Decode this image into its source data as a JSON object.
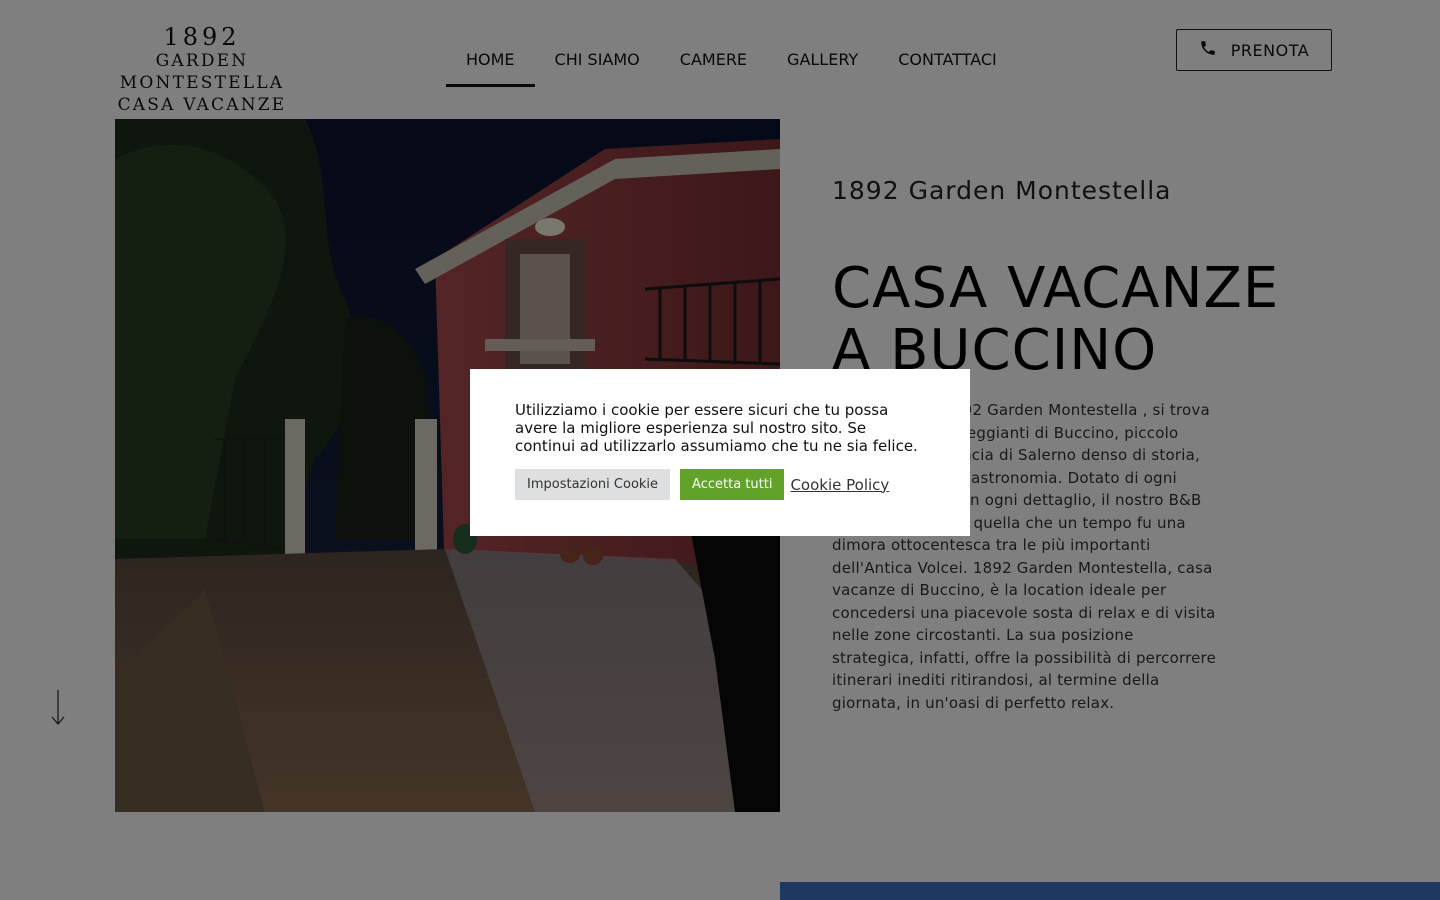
{
  "logo": {
    "year": "1892",
    "line1": "GARDEN MONTESTELLA",
    "line2": "CASA VACANZE"
  },
  "nav": {
    "items": [
      {
        "label": "HOME",
        "active": true
      },
      {
        "label": "CHI SIAMO",
        "active": false
      },
      {
        "label": "CAMERE",
        "active": false
      },
      {
        "label": "GALLERY",
        "active": false
      },
      {
        "label": "CONTATTACI",
        "active": false
      }
    ]
  },
  "cta": {
    "label": "PRENOTA",
    "icon": "phone-icon"
  },
  "hero": {
    "image_alt": "night view of pink villa with balcony and open gate",
    "scroll_icon": "arrow-down-icon"
  },
  "content": {
    "subtitle": "1892 Garden Montestella",
    "title_line1": "CASA VACANZE",
    "title_line2": "A BUCCINO",
    "intro": "Casa Vacanze 1892 Garden Montestella , si trova tra le colline verdeggianti di Buccino, piccolo borgo della provincia di Salerno denso di storia, tradizioni ed enogastronomia. Dotato di ogni comfort e curato in ogni dettaglio, il nostro B&B Buccino si erge in quella che un tempo fu una dimora ottocentesca tra le più importanti dell'Antica Volcei. 1892 Garden Montestella, casa vacanze di Buccino, è la location ideale per concedersi una piacevole sosta di relax e di visita nelle zone circostanti. La sua posizione strategica, infatti,  offre la possibilità di percorrere itinerari inediti ritirandosi, al termine della giornata, in un'oasi di perfetto relax."
  },
  "cookie": {
    "message": "Utilizziamo i cookie per essere sicuri che tu possa avere la migliore esperienza sul nostro sito. Se continui ad utilizzarlo assumiamo che tu ne sia felice.",
    "settings_label": "Impostazioni Cookie",
    "accept_label": "Accetta tutti",
    "policy_label": "Cookie Policy"
  },
  "colors": {
    "accept": "#61a229",
    "settings": "#dedfe0",
    "overlay": "rgba(0,0,0,0.5)",
    "strip": "#3a73c4"
  }
}
